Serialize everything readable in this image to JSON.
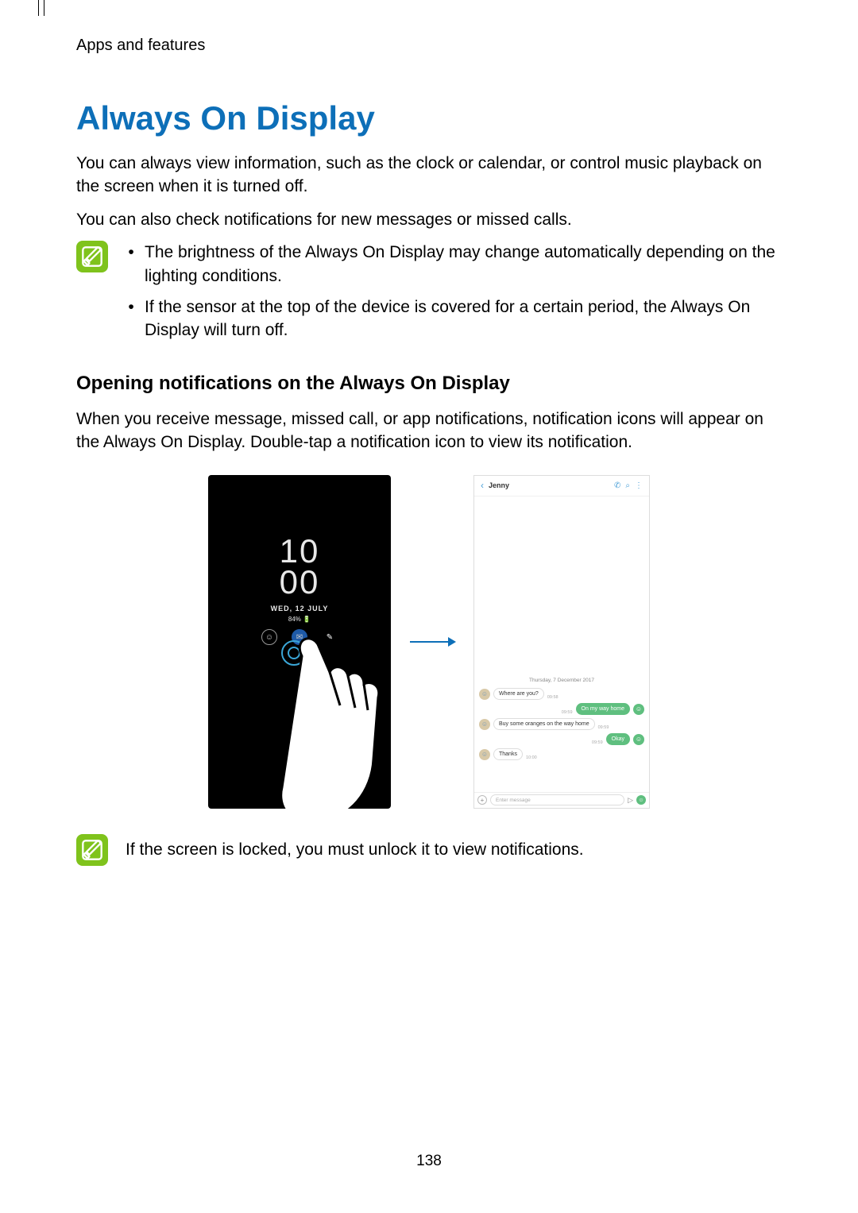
{
  "chapter": "Apps and features",
  "title": "Always On Display",
  "intro1": "You can always view information, such as the clock or calendar, or control music playback on the screen when it is turned off.",
  "intro2": "You can also check notifications for new messages or missed calls.",
  "bullets": [
    "The brightness of the Always On Display may change automatically depending on the lighting conditions.",
    "If the sensor at the top of the device is covered for a certain period, the Always On Display will turn off."
  ],
  "subheading": "Opening notifications on the Always On Display",
  "subbody": "When you receive message, missed call, or app notifications, notification icons will appear on the Always On Display. Double-tap a notification icon to view its notification.",
  "aod": {
    "hour": "10",
    "min": "00",
    "date": "WED, 12 JULY",
    "battery": "84% 🔋"
  },
  "chat": {
    "contact": "Jenny",
    "date_divider": "Thursday, 7 December 2017",
    "msgs": [
      {
        "side": "left",
        "text": "Where are you?",
        "time": "09:58"
      },
      {
        "side": "right",
        "text": "On my way home",
        "time": "09:59"
      },
      {
        "side": "left",
        "text": "Buy some oranges on the way home",
        "time": "09:59"
      },
      {
        "side": "right",
        "text": "Okay",
        "time": "09:59"
      },
      {
        "side": "left",
        "text": "Thanks",
        "time": "10:00"
      }
    ],
    "placeholder": "Enter message"
  },
  "note2": "If the screen is locked, you must unlock it to view notifications.",
  "page_number": "138"
}
